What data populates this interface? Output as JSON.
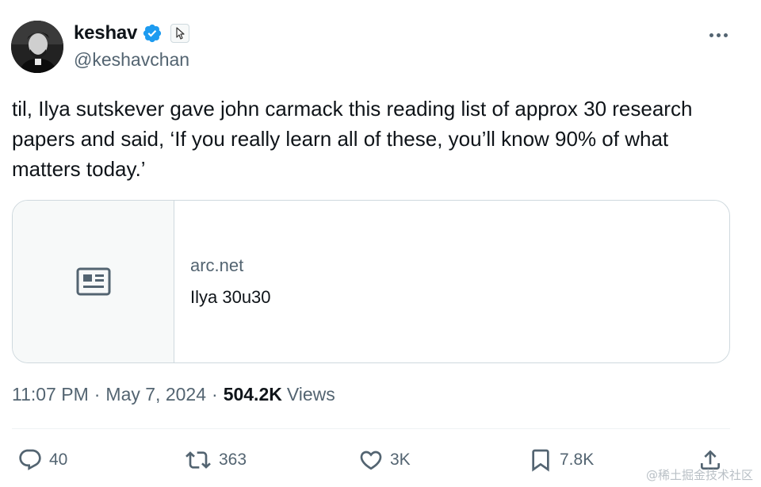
{
  "author": {
    "display_name": "keshav",
    "handle": "@keshavchan",
    "verified": true
  },
  "tweet": {
    "text": "til, Ilya sutskever gave john carmack this reading list of approx 30 research papers and said, ‘If you really learn all of these, you’ll know 90% of what matters today.’"
  },
  "link_card": {
    "domain": "arc.net",
    "title": "Ilya 30u30",
    "icon": "article-icon"
  },
  "meta": {
    "time": "11:07 PM",
    "separator": "·",
    "date": "May 7, 2024",
    "views_count": "504.2K",
    "views_label": "Views"
  },
  "actions": {
    "replies": "40",
    "reposts": "363",
    "likes": "3K",
    "bookmarks": "7.8K"
  },
  "icons": [
    "verified-badge-icon",
    "cursor-icon",
    "more-icon",
    "reply-icon",
    "repost-icon",
    "like-icon",
    "bookmark-icon",
    "share-icon"
  ],
  "colors": {
    "text": "#0f1419",
    "secondary": "#536471",
    "verified": "#1d9bf0",
    "border": "#cfd9de"
  },
  "watermark": "@稀土掘金技术社区"
}
